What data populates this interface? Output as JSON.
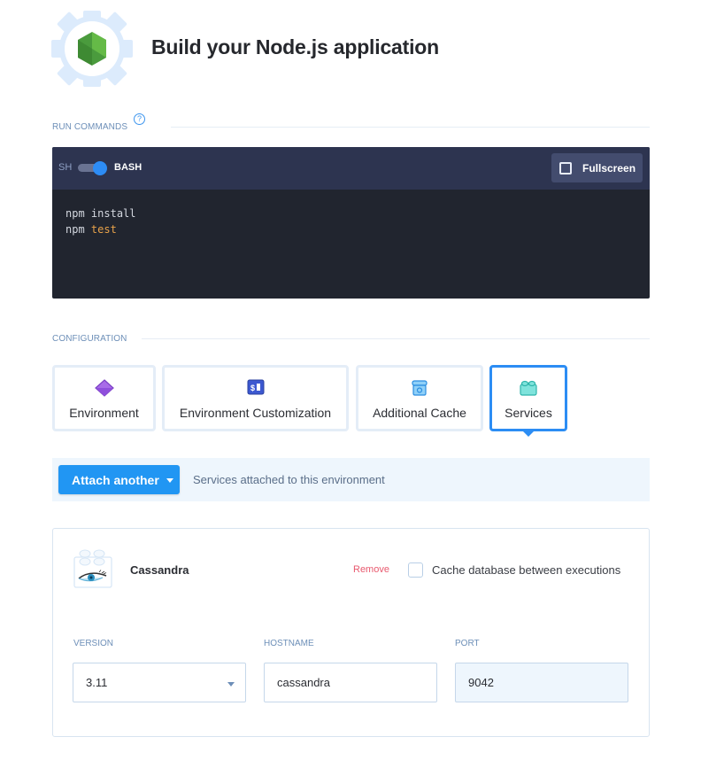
{
  "header": {
    "title": "Build your Node.js application",
    "logo_icon": "nodejs-hexagon-icon"
  },
  "run_commands": {
    "label": "RUN COMMANDS",
    "help_icon": "?",
    "shell": {
      "left_label": "SH",
      "right_label": "BASH",
      "selected": "BASH"
    },
    "fullscreen_label": "Fullscreen",
    "code_lines": [
      {
        "cmd": "npm",
        "arg": "install"
      },
      {
        "cmd": "npm",
        "arg": "test"
      }
    ],
    "colors": {
      "keyword": "#e8a24a",
      "toggle_on": "#2d8cf5"
    }
  },
  "configuration": {
    "label": "CONFIGURATION",
    "tabs": [
      {
        "label": "Environment",
        "icon": "diamond-icon",
        "active": false
      },
      {
        "label": "Environment Customization",
        "icon": "terminal-dollar-icon",
        "active": false
      },
      {
        "label": "Additional Cache",
        "icon": "cache-box-icon",
        "active": false
      },
      {
        "label": "Services",
        "icon": "services-block-icon",
        "active": true
      }
    ]
  },
  "services": {
    "attach_button": "Attach another",
    "attach_description": "Services attached to this environment",
    "items": [
      {
        "name": "Cassandra",
        "remove_label": "Remove",
        "cache_label": "Cache database between executions",
        "cache_checked": false,
        "fields": {
          "version": {
            "label": "VERSION",
            "value": "3.11"
          },
          "hostname": {
            "label": "HOSTNAME",
            "value": "cassandra"
          },
          "port": {
            "label": "PORT",
            "value": "9042"
          }
        }
      }
    ]
  },
  "theme": {
    "accent": "#2196f3",
    "danger": "#e85a6f",
    "label": "#6d8fb8",
    "terminal_bg": "#21252f",
    "terminal_bar": "#2d3450"
  }
}
